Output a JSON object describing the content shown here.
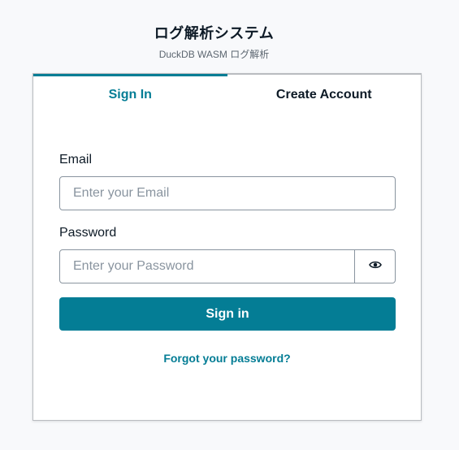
{
  "header": {
    "title": "ログ解析システム",
    "subtitle": "DuckDB WASM ログ解析"
  },
  "tabs": [
    {
      "label": "Sign In",
      "active": true
    },
    {
      "label": "Create Account",
      "active": false
    }
  ],
  "form": {
    "email": {
      "label": "Email",
      "placeholder": "Enter your Email",
      "value": ""
    },
    "password": {
      "label": "Password",
      "placeholder": "Enter your Password",
      "value": "",
      "toggle_icon": "eye-icon"
    },
    "submit_label": "Sign in",
    "forgot_label": "Forgot your password?"
  },
  "colors": {
    "accent": "#047d95",
    "background": "#f8f9fb",
    "text": "#0d1a26",
    "border": "#89949f"
  }
}
